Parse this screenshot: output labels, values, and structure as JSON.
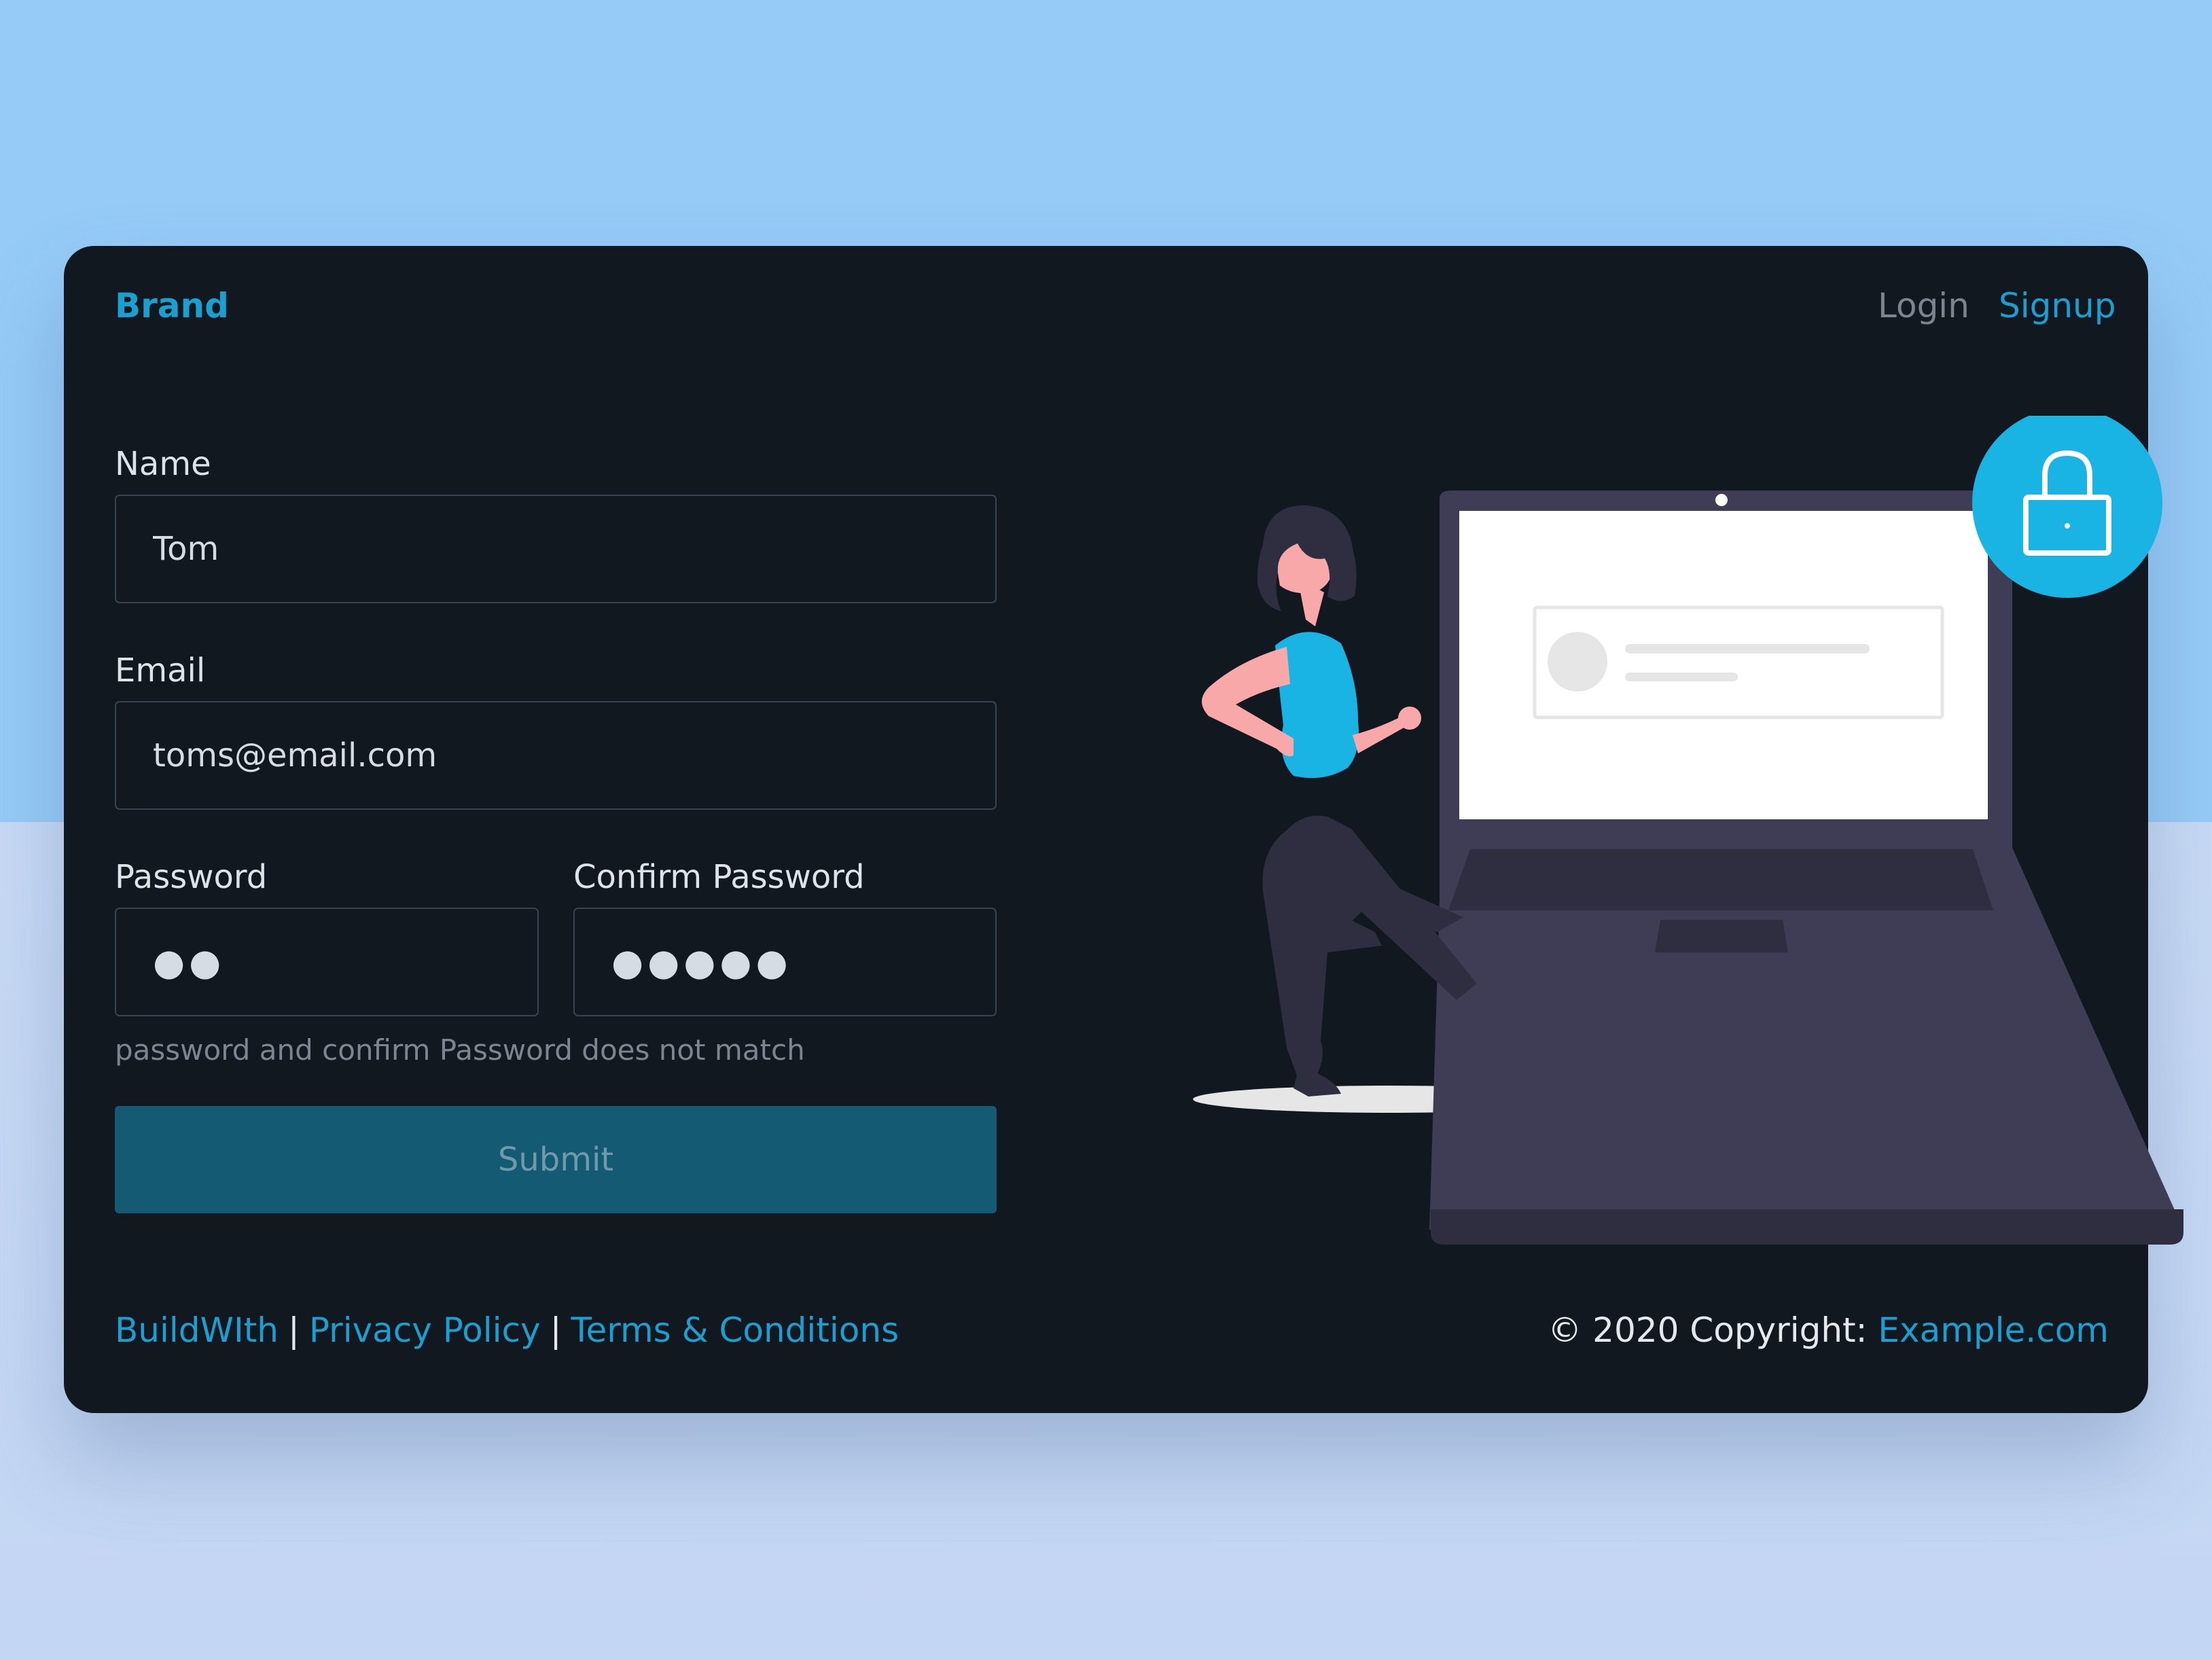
{
  "theme": {
    "accent": "#1b9fd0",
    "card_background": "#121820",
    "page_top": "#96cbf7",
    "submit_background": "#135a72"
  },
  "navbar": {
    "brand": "Brand",
    "links": [
      {
        "label": "Login"
      },
      {
        "label": "Signup"
      }
    ]
  },
  "form": {
    "name": {
      "label": "Name",
      "value": "Tom"
    },
    "email": {
      "label": "Email",
      "value": "toms@email.com"
    },
    "password": {
      "label": "Password",
      "masked_value": "●●"
    },
    "confirm_password": {
      "label": "Confirm Password",
      "masked_value": "●●●●●"
    },
    "error_message": "password and confirm Password does not match",
    "submit_label": "Submit"
  },
  "illustration": {
    "lock_icon": "lock-icon"
  },
  "footer": {
    "links": [
      {
        "label": "BuildWIth"
      },
      {
        "label": "Privacy Policy"
      },
      {
        "label": "Terms & Conditions"
      }
    ],
    "separator": "|",
    "copyright_prefix": "© 2020 Copyright:",
    "copyright_link": "Example.com"
  }
}
